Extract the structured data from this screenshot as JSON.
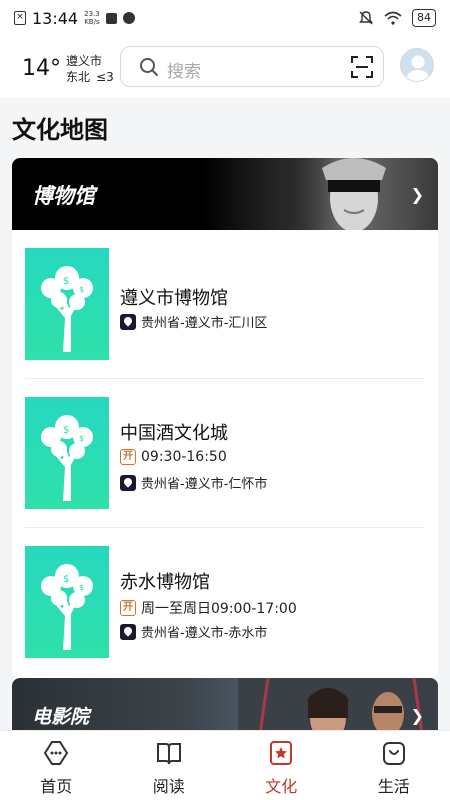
{
  "status_bar": {
    "time": "13:44",
    "net_speed_value": "23.3",
    "net_speed_unit": "KB/s",
    "battery": "84"
  },
  "header": {
    "temperature": "14°",
    "city": "遵义市",
    "wind": "东北",
    "wind_level": "≤3",
    "search_placeholder": "搜索"
  },
  "page_title": "文化地图",
  "sections": [
    {
      "title": "博物馆",
      "items": [
        {
          "name": "遵义市博物馆",
          "hours": null,
          "address": "贵州省-遵义市-汇川区"
        },
        {
          "name": "中国酒文化城",
          "hours": "09:30-16:50",
          "address": "贵州省-遵义市-仁怀市"
        },
        {
          "name": "赤水博物馆",
          "hours": "周一至周日09:00-17:00",
          "address": "贵州省-遵义市-赤水市"
        }
      ]
    },
    {
      "title": "电影院"
    }
  ],
  "open_badge": "开",
  "bottom_nav": [
    {
      "label": "首页",
      "icon": "home-icon"
    },
    {
      "label": "阅读",
      "icon": "book-icon"
    },
    {
      "label": "文化",
      "icon": "culture-icon",
      "active": true
    },
    {
      "label": "生活",
      "icon": "life-icon"
    }
  ],
  "colors": {
    "accent": "#c0392b",
    "thumb": "#2fe0a9",
    "open_badge": "#c7772e"
  }
}
